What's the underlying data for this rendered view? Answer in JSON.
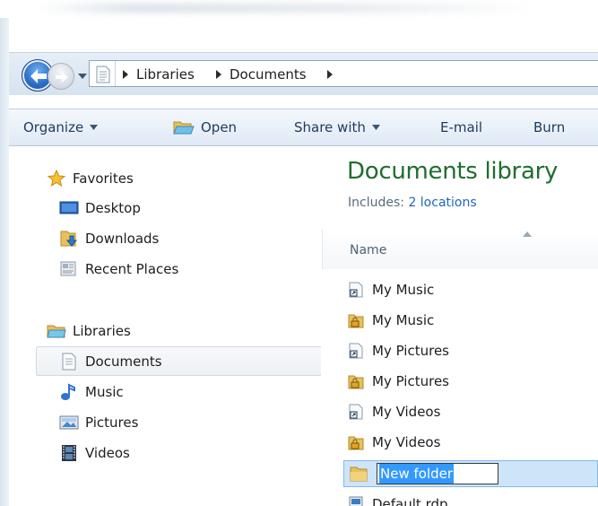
{
  "address_bar": {
    "breadcrumbs": [
      "Libraries",
      "Documents"
    ]
  },
  "command_bar": {
    "organize": "Organize",
    "open": "Open",
    "share_with": "Share with",
    "email": "E-mail",
    "burn": "Burn"
  },
  "navigation_pane": {
    "favorites": {
      "header": "Favorites",
      "items": [
        "Desktop",
        "Downloads",
        "Recent Places"
      ]
    },
    "libraries": {
      "header": "Libraries",
      "items": [
        "Documents",
        "Music",
        "Pictures",
        "Videos"
      ],
      "selected": "Documents"
    }
  },
  "content_pane": {
    "title": "Documents library",
    "includes_label": "Includes:",
    "includes_link": "2 locations",
    "column_header": "Name",
    "files": [
      {
        "name": "My Music",
        "icon": "shortcut-icon"
      },
      {
        "name": "My Music",
        "icon": "locked-folder-icon"
      },
      {
        "name": "My Pictures",
        "icon": "shortcut-icon"
      },
      {
        "name": "My Pictures",
        "icon": "locked-folder-icon"
      },
      {
        "name": "My Videos",
        "icon": "shortcut-icon"
      },
      {
        "name": "My Videos",
        "icon": "locked-folder-icon"
      }
    ],
    "rename_value": "New folder",
    "partial_file": "Default.rdp"
  },
  "colors": {
    "title_green": "#1e6e2e",
    "link_blue": "#1e66c0",
    "selection_blue": "#3399ff",
    "command_text": "#1e3b5a"
  }
}
